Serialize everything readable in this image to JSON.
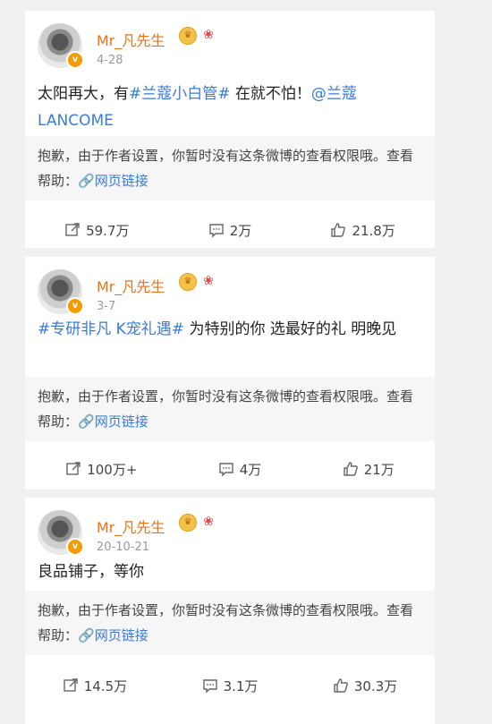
{
  "posts": [
    {
      "username": "Mr_凡先生",
      "date": "4-28",
      "text_parts": [
        "太阳再大，有",
        "#兰蔻小白管#",
        " 在就不怕！",
        "@兰蔻LANCOME"
      ],
      "notice_text": "抱歉，由于作者设置，你暂时没有这条微博的查看权限哦。查看帮助：",
      "notice_link": "网页链接",
      "repost": "59.7万",
      "comment": "2万",
      "like": "21.8万"
    },
    {
      "username": "Mr_凡先生",
      "date": "3-7",
      "text_parts": [
        "#专研非凡 K宠礼遇#",
        " 为特别的你 选最好的礼 明晚见"
      ],
      "notice_text": "抱歉，由于作者设置，你暂时没有这条微博的查看权限哦。查看帮助：",
      "notice_link": "网页链接",
      "repost": "100万+",
      "comment": "4万",
      "like": "21万"
    },
    {
      "username": "Mr_凡先生",
      "date": "20-10-21",
      "text_parts": [
        "良品铺子，等你"
      ],
      "notice_text": "抱歉，由于作者设置，你暂时没有这条微博的查看权限哦。查看帮助：",
      "notice_link": "网页链接",
      "repost": "14.5万",
      "comment": "3.1万",
      "like": "30.3万"
    }
  ],
  "icons": {
    "verified": "v-badge-icon",
    "crown": "crown-badge-icon",
    "gift": "gift-badge-icon",
    "link": "link-icon",
    "repost": "repost-icon",
    "comment": "comment-icon",
    "like": "like-icon"
  },
  "colors": {
    "username": "#e8741a",
    "link": "#3a7bd5",
    "verified": "#f59a00"
  }
}
